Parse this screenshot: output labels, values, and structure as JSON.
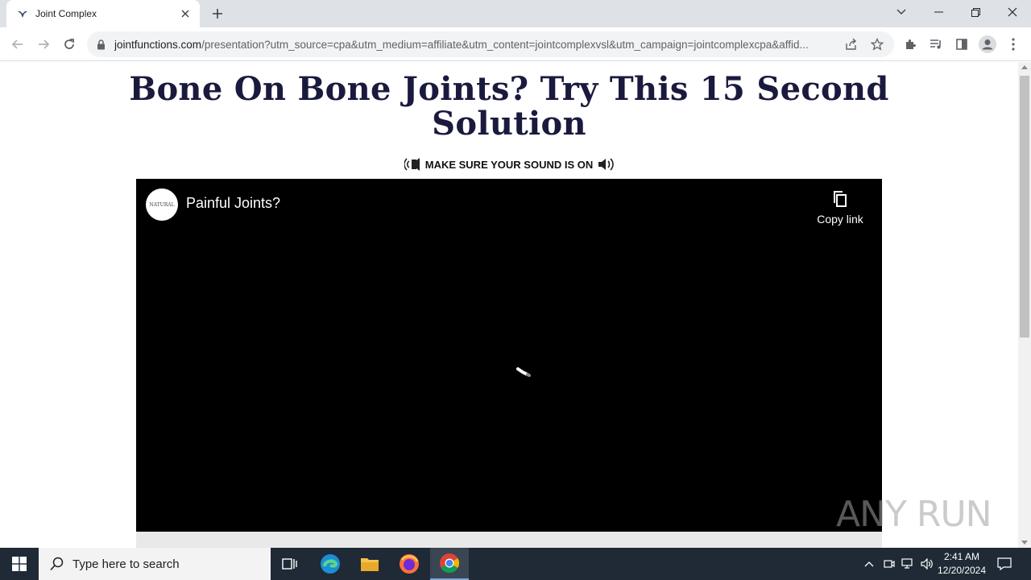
{
  "browser": {
    "tab_title": "Joint Complex",
    "url_domain": "jointfunctions.com",
    "url_rest": "/presentation?utm_source=cpa&utm_medium=affiliate&utm_content=jointcomplexvsl&utm_campaign=jointcomplexcpa&affid..."
  },
  "page": {
    "headline_line1": "Bone On Bone Joints? Try This 15 Second",
    "headline_line2": "Solution",
    "sound_notice": "MAKE SURE YOUR SOUND IS ON"
  },
  "video": {
    "title": "Painful Joints?",
    "copy_link_label": "Copy link",
    "channel_logo_text": "NATURAL"
  },
  "watermark": "ANY RUN",
  "taskbar": {
    "search_placeholder": "Type here to search",
    "time": "2:41 AM",
    "date": "12/20/2024"
  },
  "colors": {
    "headline": "#1a1a3e",
    "taskbar": "#1f2a36",
    "tabstrip": "#dee1e6"
  }
}
